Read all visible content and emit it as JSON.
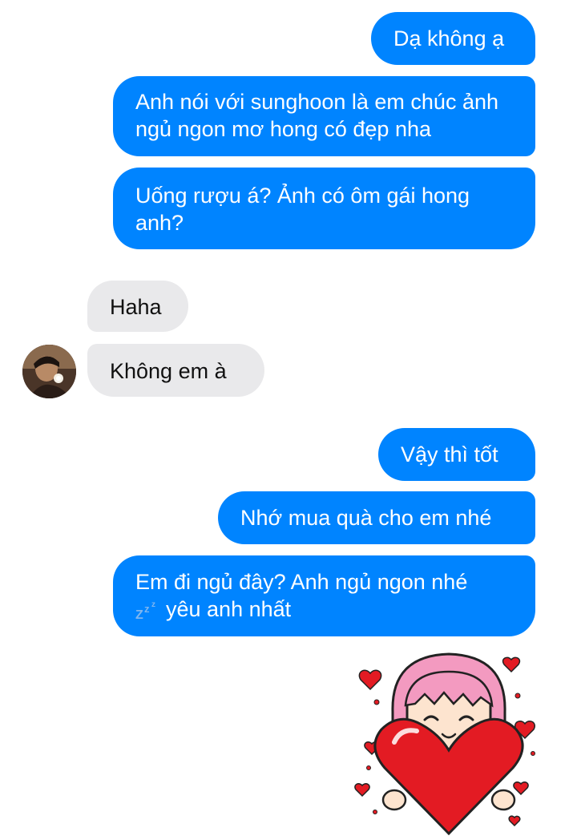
{
  "messages": {
    "m1": "Dạ không ạ",
    "m2": "Anh nói với sunghoon là em chúc ảnh ngủ ngon mơ hong có đẹp nha",
    "m3": "Uống rượu á? Ảnh có ôm gái hong anh?",
    "m4": "Haha",
    "m5": "Không em à",
    "m6": "Vậy thì tốt",
    "m7": "Nhớ mua quà cho em nhé",
    "m8_line1": "Em đi ngủ đây? Anh ngủ ngon nhé",
    "m8_line2": "yêu anh nhất"
  },
  "colors": {
    "outgoing_bubble": "#0084ff",
    "incoming_bubble": "#e9e9eb",
    "sticker_heart": "#e31b23",
    "sticker_hair": "#f39ac0"
  },
  "icons": {
    "zzz": "sleeping-zzz-emoji-icon",
    "sticker": "girl-hugging-heart-sticker",
    "avatar": "contact-avatar-photo"
  }
}
